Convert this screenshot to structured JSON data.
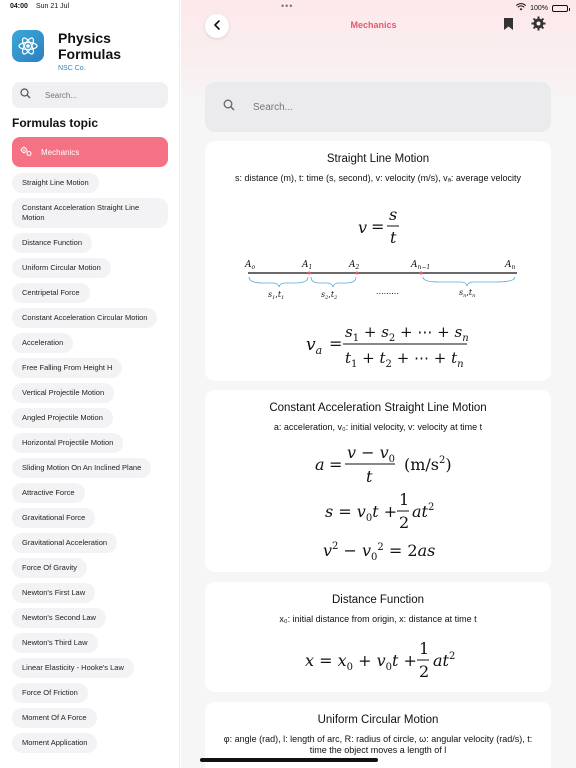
{
  "status": {
    "time": "04:00",
    "date": "Sun 21 Jul",
    "battery": "100%"
  },
  "app": {
    "title": "Physics Formulas",
    "subtitle": "NSC Co."
  },
  "sidebar": {
    "search_placeholder": "Search...",
    "heading": "Formulas topic",
    "active_topic": "Mechanics",
    "items": [
      "Straight Line Motion",
      "Constant Acceleration Straight Line Motion",
      "Distance Function",
      "Uniform Circular Motion",
      "Centripetal Force",
      "Constant Acceleration Circular Motion",
      "Acceleration",
      "Free Falling From Height H",
      "Vertical Projectile Motion",
      "Angled Projectile Motion",
      "Horizontal Projectile Motion",
      "Sliding Motion On An Inclined Plane",
      "Attractive Force",
      "Gravitational Force",
      "Gravitational Acceleration",
      "Force Of Gravity",
      "Newton's First Law",
      "Newton's Second Law",
      "Newton's Third Law",
      "Linear Elasticity - Hooke's Law",
      "Force Of Friction",
      "Moment Of A Force",
      "Moment Application"
    ]
  },
  "main": {
    "title": "Mechanics",
    "search_placeholder": "Search...",
    "cards": [
      {
        "title": "Straight Line Motion",
        "desc": "s: distance (m), t: time (s, second), v: velocity (m/s), vₐ: average velocity"
      },
      {
        "title": "Constant Acceleration Straight Line Motion",
        "desc": "a: acceleration, v₀: initial velocity, v: velocity at time t"
      },
      {
        "title": "Distance Function",
        "desc": "x₀: initial distance from origin, x: distance at time t"
      },
      {
        "title": "Uniform Circular Motion",
        "desc": "φ: angle (rad), l: length of arc, R: radius of circle, ω: angular velocity (rad/s), t: time the object moves a length of l"
      }
    ],
    "diagram_labels": [
      "A",
      "o",
      "A",
      "1",
      "A",
      "2",
      "A",
      "n−1",
      "A",
      "n",
      "s",
      "1",
      "t",
      "1",
      "s",
      "2",
      "t",
      "2",
      "s",
      "n",
      "t",
      "n",
      "........."
    ],
    "formula_text": [
      "v",
      "s",
      "t",
      "(m/s",
      "2",
      ")"
    ]
  },
  "icons": {
    "accent": "#f47284",
    "title_color": "#e8576d"
  }
}
